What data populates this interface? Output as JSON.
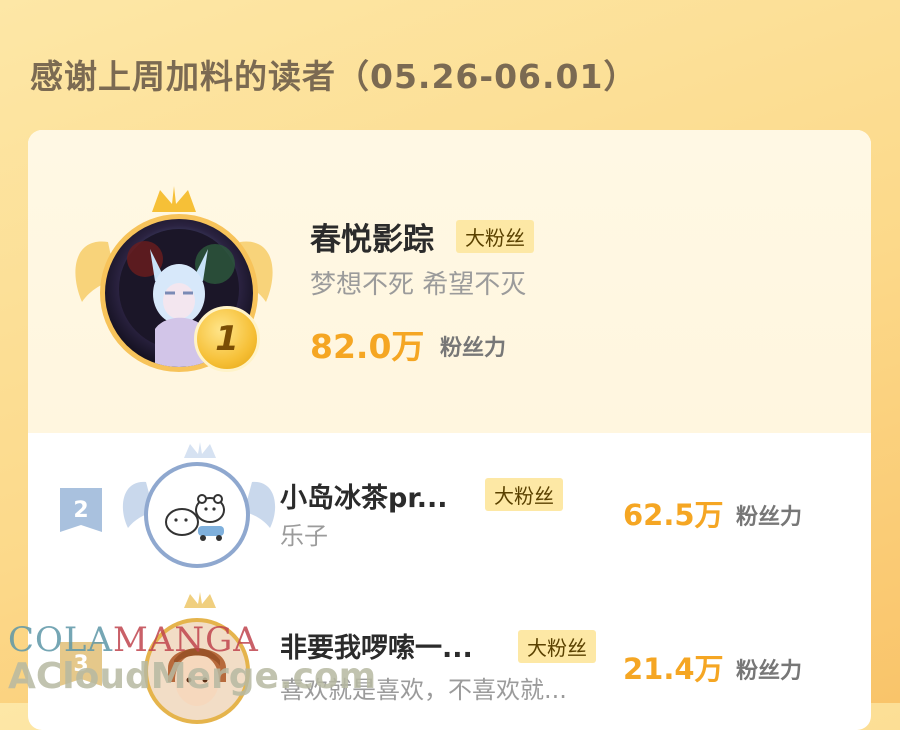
{
  "header": {
    "title": "感谢上周加料的读者（05.26-06.01）"
  },
  "top_reader": {
    "rank": "1",
    "name": "春悦影踪",
    "tag": "大粉丝",
    "motto": "梦想不死 希望不灭",
    "value": "82.0万",
    "unit": "粉丝力"
  },
  "readers": [
    {
      "rank": "2",
      "name": "小岛冰茶pr...",
      "tag": "大粉丝",
      "motto": "乐子",
      "value": "62.5万",
      "unit": "粉丝力"
    },
    {
      "rank": "3",
      "name": "非要我啰嗦一...",
      "tag": "大粉丝",
      "motto": "喜欢就是喜欢，不喜欢就...",
      "value": "21.4万",
      "unit": "粉丝力"
    }
  ],
  "watermark": {
    "line1_a": "COLA",
    "line1_b": "MANGA",
    "line2": "ACloudMerge.com"
  },
  "colors": {
    "accent": "#f5a623",
    "tag_bg": "#fde8a5",
    "rank2": "#a9c1de",
    "rank1": "#f6c037"
  }
}
